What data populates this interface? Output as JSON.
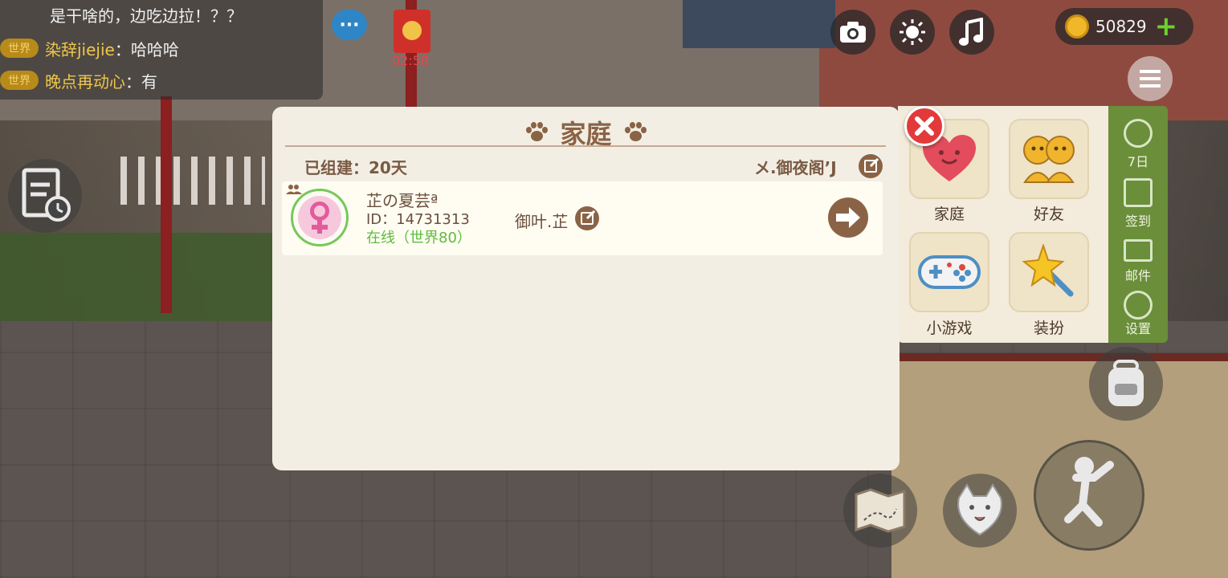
{
  "chat": {
    "lines": [
      {
        "tag": "",
        "name": "",
        "text": "是干啥的，边吃边拉！？？"
      },
      {
        "tag": "世界",
        "name": "染辞jiejie",
        "text": "：哈哈哈"
      },
      {
        "tag": "世界",
        "name": "晚点再动心",
        "text": "：有"
      }
    ]
  },
  "redpack": {
    "timer": "02:58"
  },
  "currency": {
    "coins": "50829"
  },
  "top_icons": [
    "camera-icon",
    "brightness-icon",
    "music-icon"
  ],
  "menu": {
    "items": [
      {
        "label": "家庭",
        "icon": "heart-icon"
      },
      {
        "label": "好友",
        "icon": "friends-icon"
      },
      {
        "label": "小游戏",
        "icon": "gamepad-icon"
      },
      {
        "label": "装扮",
        "icon": "star-wand-icon"
      }
    ],
    "sidebar": [
      {
        "label": "7日",
        "icon": "seven-day-icon"
      },
      {
        "label": "签到",
        "icon": "checkin-icon"
      },
      {
        "label": "邮件",
        "icon": "mail-icon"
      },
      {
        "label": "设置",
        "icon": "gear-icon"
      }
    ]
  },
  "dialog": {
    "title": "家庭",
    "built_label": "已组建：20天",
    "family_name": "メ.御夜阁’J",
    "member": {
      "name": "芷の夏芸ª",
      "id": "ID：14731313",
      "status": "在线（世界80）",
      "nickname": "御叶.芷"
    }
  },
  "colors": {
    "dialog_bg": "#f2eee4",
    "brown": "#8a6346",
    "online_green": "#5dbb3c",
    "close_red": "#e23a3a",
    "sidebar_green": "#6b8e3a"
  }
}
